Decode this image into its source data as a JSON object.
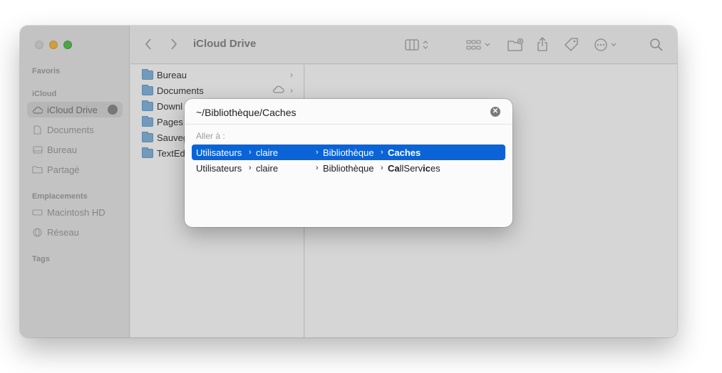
{
  "window": {
    "title": "iCloud Drive"
  },
  "sidebar": {
    "sections": [
      {
        "label": "Favoris"
      },
      {
        "label": "iCloud"
      },
      {
        "label": "Emplacements"
      },
      {
        "label": "Tags"
      }
    ],
    "icloud_items": [
      {
        "label": "iCloud Drive",
        "icon": "cloud-icon",
        "active": true
      },
      {
        "label": "Documents",
        "icon": "document-icon"
      },
      {
        "label": "Bureau",
        "icon": "desktop-icon"
      },
      {
        "label": "Partagé",
        "icon": "shared-folder-icon"
      }
    ],
    "location_items": [
      {
        "label": "Macintosh HD",
        "icon": "disk-icon"
      },
      {
        "label": "Réseau",
        "icon": "network-icon"
      }
    ]
  },
  "files": [
    {
      "name": "Bureau",
      "icon": "folder-icon"
    },
    {
      "name": "Documents",
      "icon": "folder-icon",
      "cloud": true
    },
    {
      "name": "Downl",
      "icon": "folder-icon"
    },
    {
      "name": "Pages",
      "icon": "folder-icon"
    },
    {
      "name": "Sauveg",
      "icon": "folder-icon"
    },
    {
      "name": "TextEd",
      "icon": "folder-icon"
    }
  ],
  "goto_dialog": {
    "path_value": "~/Bibliothèque/Caches",
    "goto_label": "Aller à :",
    "suggestions": [
      {
        "parts": [
          "Utilisateurs",
          "claire",
          "Bibliothèque",
          "Caches"
        ],
        "selected": true
      },
      {
        "parts": [
          "Utilisateurs",
          "claire",
          "Bibliothèque",
          "CallServices"
        ],
        "selected": false,
        "match_a": "Ca",
        "rest_a": "llServ",
        "match_b": "ic",
        "rest_b": "es"
      }
    ]
  },
  "colors": {
    "selection": "#0a64d8",
    "traffic_min": "#f5bd4f",
    "traffic_max": "#5fc454"
  }
}
